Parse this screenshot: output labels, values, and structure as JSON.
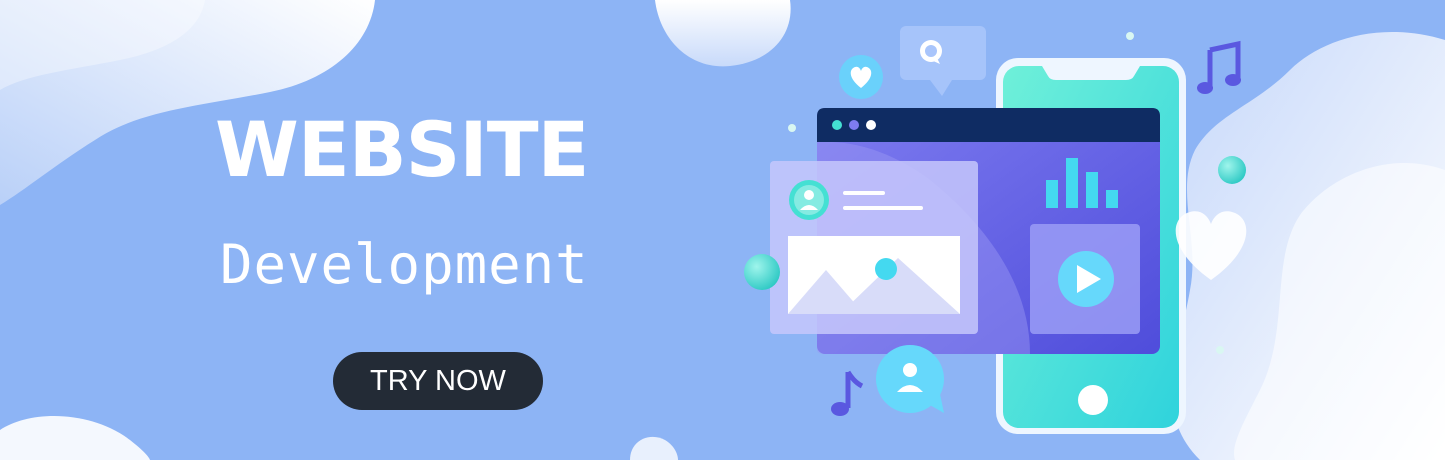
{
  "hero": {
    "headline": "WEBSITE",
    "subheadline": "Development",
    "cta_label": "TRY NOW"
  },
  "colors": {
    "background": "#8db4f5",
    "phone": "#44e0d3",
    "browser_header": "#0f2c63",
    "accent_purple": "#5a58e0",
    "cta": "#232b36"
  },
  "icons": [
    "heart-icon",
    "chat-bubble-icon",
    "music-note-icon",
    "user-icon",
    "bar-chart-icon",
    "image-icon",
    "play-icon",
    "phone-home-button-icon"
  ]
}
